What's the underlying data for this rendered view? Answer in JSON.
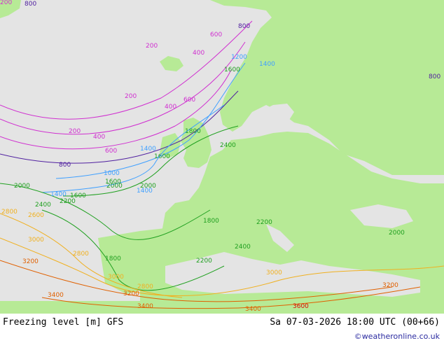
{
  "footer": {
    "left_label": "Freezing level [m] GFS",
    "right_label": "Sa 07-03-2026 18:00 UTC (00+66)",
    "credit": "©weatheronline.co.uk"
  },
  "colors": {
    "sea": "#e4e4e4",
    "land": "#b7ea96",
    "contour_200_600": "#d030d0",
    "contour_800": "#5020a0",
    "contour_1000_1400": "#40a0ff",
    "contour_1600_2400": "#20a020",
    "contour_2600_3000": "#f0b020",
    "contour_3200_3600": "#e06000"
  },
  "contour_labels": [
    {
      "text": "200",
      "color": "#d030d0"
    },
    {
      "text": "200",
      "color": "#d030d0"
    },
    {
      "text": "200",
      "color": "#d030d0"
    },
    {
      "text": "200",
      "color": "#d030d0"
    },
    {
      "text": "400",
      "color": "#d030d0"
    },
    {
      "text": "400",
      "color": "#d030d0"
    },
    {
      "text": "400",
      "color": "#d030d0"
    },
    {
      "text": "600",
      "color": "#d030d0"
    },
    {
      "text": "600",
      "color": "#d030d0"
    },
    {
      "text": "600",
      "color": "#d030d0"
    },
    {
      "text": "800",
      "color": "#5020a0"
    },
    {
      "text": "800",
      "color": "#5020a0"
    },
    {
      "text": "800",
      "color": "#5020a0"
    },
    {
      "text": "800",
      "color": "#5020a0"
    },
    {
      "text": "1000",
      "color": "#40a0ff"
    },
    {
      "text": "1200",
      "color": "#40a0ff"
    },
    {
      "text": "1400",
      "color": "#40a0ff"
    },
    {
      "text": "1400",
      "color": "#40a0ff"
    },
    {
      "text": "1400",
      "color": "#40a0ff"
    },
    {
      "text": "1400",
      "color": "#40a0ff"
    },
    {
      "text": "1600",
      "color": "#20a020"
    },
    {
      "text": "1600",
      "color": "#20a020"
    },
    {
      "text": "1600",
      "color": "#20a020"
    },
    {
      "text": "1600",
      "color": "#20a020"
    },
    {
      "text": "1800",
      "color": "#20a020"
    },
    {
      "text": "1800",
      "color": "#20a020"
    },
    {
      "text": "1800",
      "color": "#20a020"
    },
    {
      "text": "2000",
      "color": "#20a020"
    },
    {
      "text": "2000",
      "color": "#20a020"
    },
    {
      "text": "2000",
      "color": "#20a020"
    },
    {
      "text": "2000",
      "color": "#20a020"
    },
    {
      "text": "2200",
      "color": "#20a020"
    },
    {
      "text": "2200",
      "color": "#20a020"
    },
    {
      "text": "2200",
      "color": "#20a020"
    },
    {
      "text": "2400",
      "color": "#20a020"
    },
    {
      "text": "2400",
      "color": "#20a020"
    },
    {
      "text": "2400",
      "color": "#20a020"
    },
    {
      "text": "2600",
      "color": "#f0b020"
    },
    {
      "text": "2800",
      "color": "#f0b020"
    },
    {
      "text": "2800",
      "color": "#f0b020"
    },
    {
      "text": "2800",
      "color": "#f0b020"
    },
    {
      "text": "3000",
      "color": "#f0b020"
    },
    {
      "text": "3000",
      "color": "#f0b020"
    },
    {
      "text": "3000",
      "color": "#f0b020"
    },
    {
      "text": "3200",
      "color": "#e06000"
    },
    {
      "text": "3200",
      "color": "#e06000"
    },
    {
      "text": "3200",
      "color": "#e06000"
    },
    {
      "text": "3400",
      "color": "#e06000"
    },
    {
      "text": "3400",
      "color": "#e06000"
    },
    {
      "text": "3400",
      "color": "#e06000"
    },
    {
      "text": "3600",
      "color": "#e00000"
    }
  ]
}
